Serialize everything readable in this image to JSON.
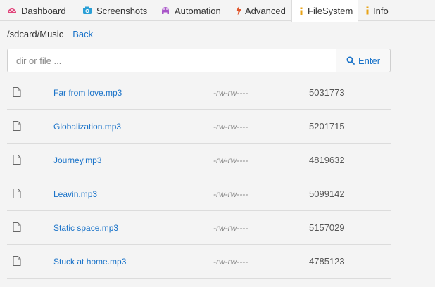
{
  "tabs": [
    {
      "label": "Dashboard",
      "icon": "dashboard-icon",
      "icon_color": "#e0457b"
    },
    {
      "label": "Screenshots",
      "icon": "camera-icon",
      "icon_color": "#2a9fd6"
    },
    {
      "label": "Automation",
      "icon": "android-icon",
      "icon_color": "#a855c8"
    },
    {
      "label": "Advanced",
      "icon": "bolt-icon",
      "icon_color": "#e0552b"
    },
    {
      "label": "FileSystem",
      "icon": "info-icon",
      "icon_color": "#e8a317",
      "active": true
    },
    {
      "label": "Info",
      "icon": "info-icon",
      "icon_color": "#e8a317"
    }
  ],
  "path": {
    "current": "/sdcard/Music",
    "back_label": "Back"
  },
  "search": {
    "placeholder": "dir or file ...",
    "value": "",
    "button_label": "Enter"
  },
  "files": [
    {
      "name": "Far from love.mp3",
      "perm": "-rw-rw----",
      "size": "5031773"
    },
    {
      "name": "Globalization.mp3",
      "perm": "-rw-rw----",
      "size": "5201715"
    },
    {
      "name": "Journey.mp3",
      "perm": "-rw-rw----",
      "size": "4819632"
    },
    {
      "name": "Leavin.mp3",
      "perm": "-rw-rw----",
      "size": "5099142"
    },
    {
      "name": "Static space.mp3",
      "perm": "-rw-rw----",
      "size": "5157029"
    },
    {
      "name": "Stuck at home.mp3",
      "perm": "-rw-rw----",
      "size": "4785123"
    }
  ],
  "colors": {
    "link": "#1a73c9",
    "border": "#dcdcdc"
  }
}
